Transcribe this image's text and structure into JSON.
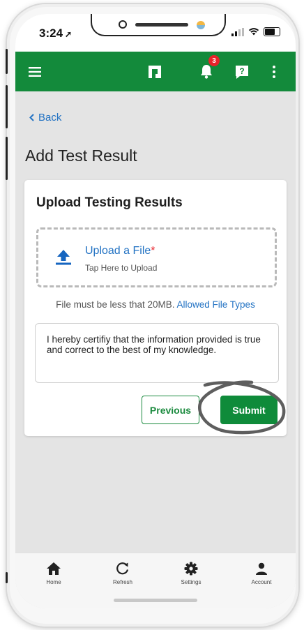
{
  "status": {
    "time": "3:24"
  },
  "appbar": {
    "notification_count": "3"
  },
  "nav": {
    "back_label": "Back"
  },
  "page": {
    "title": "Add Test Result"
  },
  "upload_card": {
    "title": "Upload Testing Results",
    "upload_label": "Upload a File",
    "required_mark": "*",
    "upload_hint": "Tap Here to Upload",
    "file_note": "File must be less that 20MB.",
    "allowed_types_link": "Allowed File Types",
    "certification": "I hereby certifiy that the information provided is true and correct to the best of my knowledge.",
    "previous_label": "Previous",
    "submit_label": "Submit"
  },
  "tabbar": {
    "items": [
      {
        "label": "Home",
        "icon": "home-icon"
      },
      {
        "label": "Refresh",
        "icon": "refresh-icon"
      },
      {
        "label": "Settings",
        "icon": "gear-icon"
      },
      {
        "label": "Account",
        "icon": "user-icon"
      }
    ]
  },
  "colors": {
    "brand_green": "#138a3b",
    "link_blue": "#2272c3",
    "badge_red": "#e8232a",
    "background": "#e4e4e4"
  }
}
